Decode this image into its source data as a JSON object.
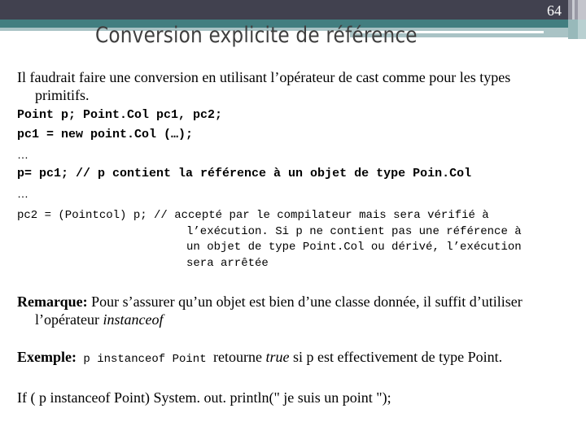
{
  "slide": {
    "page_number": "64",
    "title": "Conversion explicite de référence",
    "accent_colors": {
      "header_dark": "#41414f",
      "header_teal": "#427e80",
      "header_light": "#a9c3c5"
    }
  },
  "body": {
    "intro_line1": "Il faudrait faire une conversion en utilisant l’opérateur de cast comme pour les types",
    "intro_line2": "primitifs.",
    "code_lines": [
      "Point p; Point.Col pc1, pc2;",
      "pc1 = new point.Col (…);",
      "…",
      "p= pc1; // p contient la référence à un objet de type Poin.Col",
      "…"
    ],
    "cast_code": "pc2 = (Pointcol) p; // accepté par le compilateur mais sera vérifié à",
    "cast_continuation": [
      "l’exécution. Si p ne contient pas une référence à",
      "un objet de type Point.Col ou dérivé, l’exécution",
      "sera arrêtée"
    ],
    "remarque": {
      "label": "Remarque:",
      "text": " Pour s’assurer qu’un objet est bien d’une classe donnée, il suffit d’utiliser",
      "line2_text": "l’opérateur ",
      "line2_italic": "instanceof"
    },
    "exemple": {
      "label": "Exemple:",
      "code": " p instanceof Point ",
      "text_before_italic": " retourne ",
      "italic": "true",
      "text_after_italic": " si p est effectivement de type Point."
    },
    "if_line": "If ( p instanceof Point) System. out. println(\" je suis un point \");"
  }
}
